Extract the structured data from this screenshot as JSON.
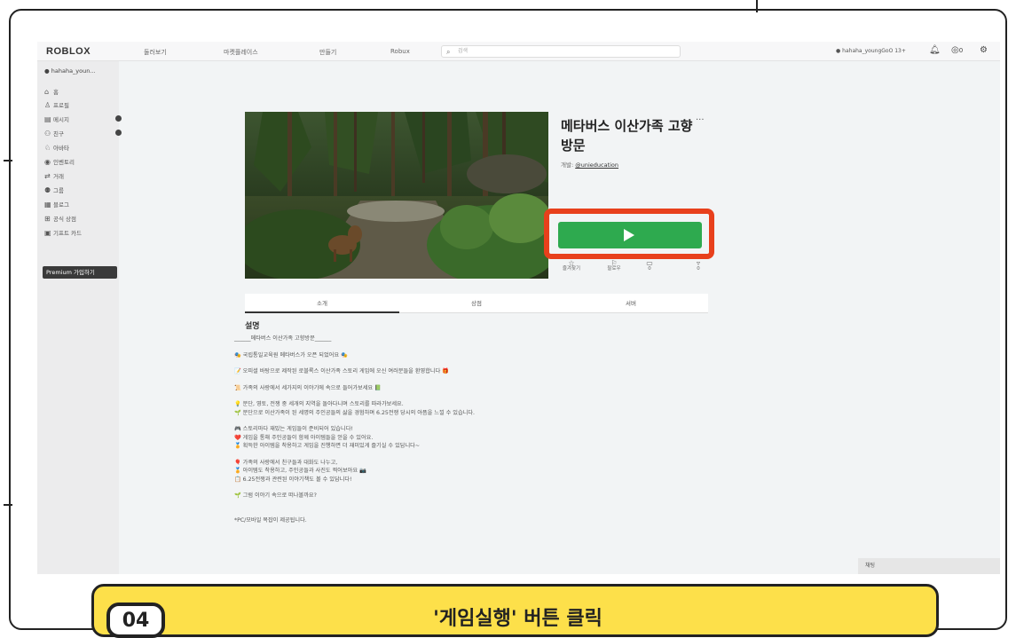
{
  "topbar": {
    "logo": "ROBLOX",
    "nav": [
      "둘러보기",
      "마켓플레이스",
      "만들기",
      "Robux"
    ],
    "search_placeholder": "검색",
    "username": "hahaha_youngGoO 13+",
    "robux_count": "0"
  },
  "sidebar": {
    "username": "hahaha_youn...",
    "items": [
      {
        "icon": "home-icon",
        "label": "홈"
      },
      {
        "icon": "profile-icon",
        "label": "프로필"
      },
      {
        "icon": "message-icon",
        "label": "메시지",
        "badge": true
      },
      {
        "icon": "friends-icon",
        "label": "친구",
        "badge": true
      },
      {
        "icon": "avatar-icon",
        "label": "아바타"
      },
      {
        "icon": "inventory-icon",
        "label": "인벤토리"
      },
      {
        "icon": "trade-icon",
        "label": "거래"
      },
      {
        "icon": "groups-icon",
        "label": "그룹"
      },
      {
        "icon": "blog-icon",
        "label": "블로그"
      },
      {
        "icon": "store-icon",
        "label": "공식 상점"
      },
      {
        "icon": "giftcard-icon",
        "label": "기프트 카드"
      }
    ],
    "premium_label": "Premium 가입하기"
  },
  "game": {
    "title": "메타버스 이산가족 고향방문",
    "creator_prefix": "개발: ",
    "creator": "@unieducation",
    "play_label": "Play",
    "stats": [
      {
        "icon": "favorite-icon",
        "label": "즐겨찾기",
        "value": ""
      },
      {
        "icon": "follow-icon",
        "label": "팔로우",
        "value": ""
      },
      {
        "icon": "thumbs-up-icon",
        "label": "",
        "value": "0"
      },
      {
        "icon": "thumbs-down-icon",
        "label": "",
        "value": "0"
      }
    ]
  },
  "tabs": [
    "소개",
    "상점",
    "서버"
  ],
  "description": {
    "heading": "설명",
    "lines": [
      "______메타버스 이산가족 고향방문______",
      "",
      "🎭 국립통일교육원 메타버스가 오픈 되었어요 🎭",
      "",
      "📝 오피셜 바탕으로 제작된 로블록스 이산가족 스토리 게임에 오신 여러분들을 환영합니다 🎁",
      "",
      "📜 가족의 사랑에서 세가지의 이야기에 속으로 들어가보세요 📗",
      "",
      "💡 분단, 영토, 전쟁 중 세개의 지역을 돌아다니며 스토리를 따라가보세요.",
      "🌱 분단으로 이산가족이 된 세명의 주인공들의 삶을 경험하며 6.25전쟁 당시의 아픔을 느낄 수 있습니다.",
      "",
      "🎮 스토리마다 재밌는 게임들이 준비되어 있습니다!",
      "❤️ 게임을 통해 주인공들이 함께 아이템들을 얻을 수 있어요.",
      "🏅 획득한 아이템을 착용하고 게임을 진행하면 더 재미있게 즐기실 수 있답니다~",
      "",
      "🎈 가족의 사랑에서 친구들과 대화도 나누고,",
      "🏅 아이템도 착용하고, 주인공들과 사진도 찍어보아요 📷",
      "📋 6.25전쟁과 관련된 이야기책도 볼 수 있답니다!",
      "",
      "🌱 그럼 이야기 속으로 떠나볼까요?",
      "",
      "",
      "*PC/모바일 복잡이 제공됩니다."
    ]
  },
  "chat_label": "채팅",
  "caption": {
    "step": "04",
    "text": "'게임실행' 버튼 클릭"
  },
  "colors": {
    "play_green": "#2eaa4f",
    "highlight_red": "#e8401c",
    "caption_yellow": "#fde04a"
  }
}
